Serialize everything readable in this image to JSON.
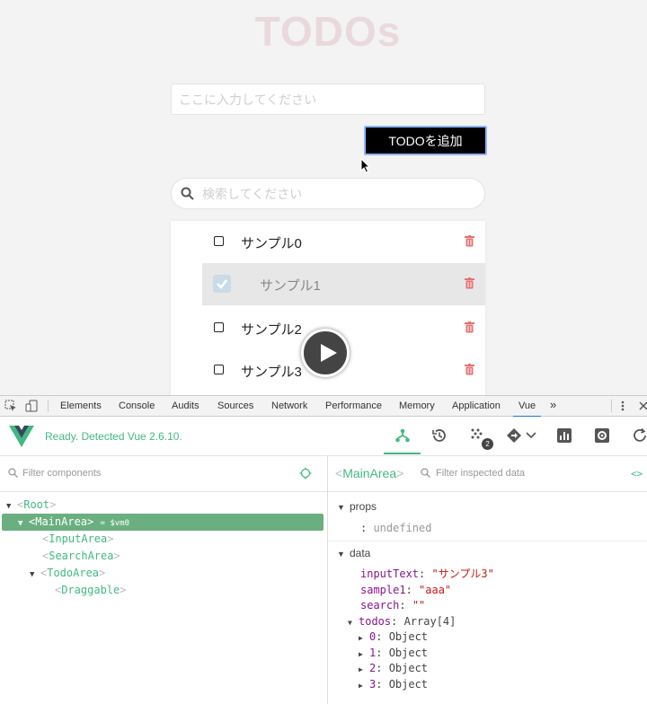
{
  "app": {
    "title": "TODOs",
    "input_placeholder": "ここに入力してください",
    "add_button": "TODOを追加",
    "search_placeholder": "検索してください",
    "todos": [
      {
        "label": "サンプル0",
        "checked": false
      },
      {
        "label": "サンプル1",
        "checked": true
      },
      {
        "label": "サンプル2",
        "checked": false
      },
      {
        "label": "サンプル3",
        "checked": false
      }
    ]
  },
  "devtools": {
    "tabs": [
      "Elements",
      "Console",
      "Audits",
      "Sources",
      "Network",
      "Performance",
      "Memory",
      "Application",
      "Vue"
    ],
    "active_tab": "Vue",
    "more": "»"
  },
  "vue": {
    "status": "Ready. Detected Vue 2.6.10.",
    "badge_count": "2",
    "accent": "#42b983"
  },
  "components": {
    "filter_placeholder": "Filter components",
    "tree": [
      {
        "name": "Root",
        "arrow": "▼"
      },
      {
        "name": "MainArea",
        "arrow": "▼",
        "vm": "= $vm0"
      },
      {
        "name": "InputArea",
        "arrow": ""
      },
      {
        "name": "SearchArea",
        "arrow": ""
      },
      {
        "name": "TodoArea",
        "arrow": "▼"
      },
      {
        "name": "Draggable",
        "arrow": ""
      }
    ]
  },
  "inspector": {
    "component": "MainArea",
    "filter_placeholder": "Filter inspected data",
    "code_icon": "<>",
    "props_title": "props",
    "props": [
      {
        "key": "",
        "value": "undefined"
      }
    ],
    "data_title": "data",
    "data": [
      {
        "key": "inputText",
        "value": "\"サンプル3\""
      },
      {
        "key": "sample1",
        "value": "\"aaa\""
      },
      {
        "key": "search",
        "value": "\"\""
      }
    ],
    "todos_key": "todos",
    "todos_type": "Array[4]",
    "todos_items": [
      {
        "key": "0",
        "value": "Object"
      },
      {
        "key": "1",
        "value": "Object"
      },
      {
        "key": "2",
        "value": "Object"
      },
      {
        "key": "3",
        "value": "Object"
      }
    ]
  }
}
